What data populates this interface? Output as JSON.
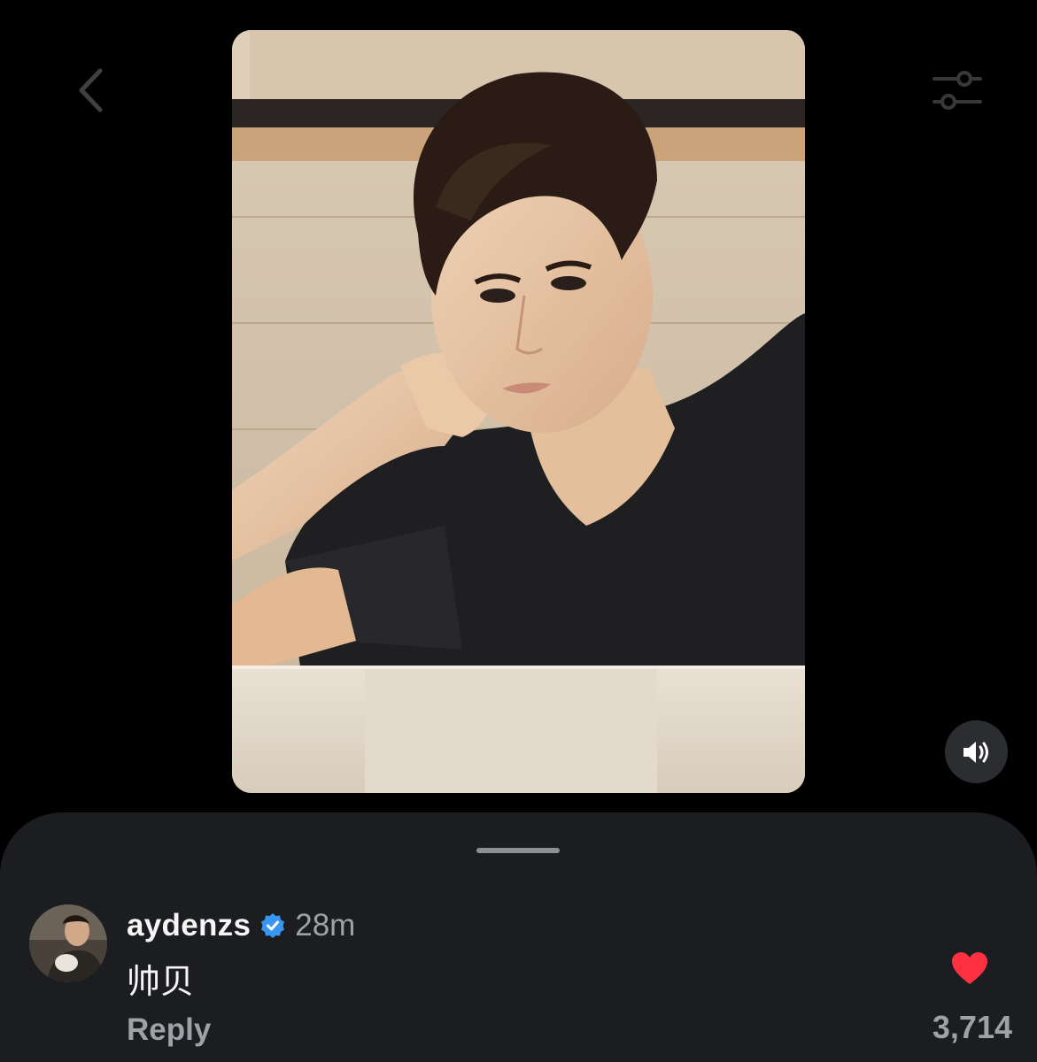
{
  "icons": {
    "back": "chevron-left-icon",
    "filter": "sliders-icon",
    "sound": "speaker-icon",
    "verified": "verified-badge-icon",
    "like": "heart-icon"
  },
  "colors": {
    "background": "#000000",
    "sheet": "#1b1d21",
    "verified": "#3797f0",
    "like": "#ff3040",
    "secondary_text": "#a0a1a6"
  },
  "comment": {
    "username": "aydenzs",
    "time": "28m",
    "text": "帅贝",
    "reply_label": "Reply",
    "likes": "3,714",
    "liked": true
  }
}
